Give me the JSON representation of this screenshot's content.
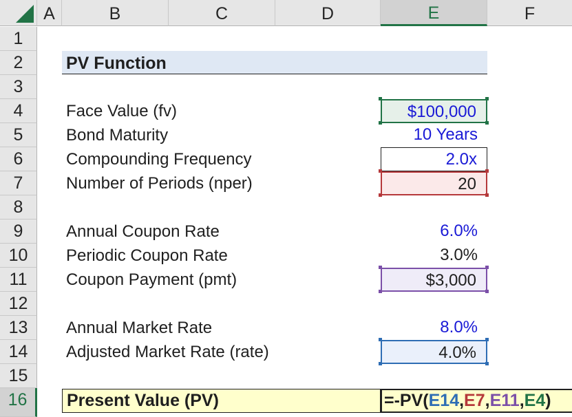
{
  "columns": [
    "A",
    "B",
    "C",
    "D",
    "E",
    "F"
  ],
  "rows": [
    "1",
    "2",
    "3",
    "4",
    "5",
    "6",
    "7",
    "8",
    "9",
    "10",
    "11",
    "12",
    "13",
    "14",
    "15",
    "16"
  ],
  "title": "PV Function",
  "items": [
    {
      "label": "Face Value (fv)",
      "value": "$100,000"
    },
    {
      "label": "Bond Maturity",
      "value": "10 Years"
    },
    {
      "label": "Compounding Frequency",
      "value": "2.0x"
    },
    {
      "label": "Number of Periods (nper)",
      "value": "20"
    },
    {
      "label": "Annual Coupon Rate",
      "value": "6.0%"
    },
    {
      "label": "Periodic Coupon Rate",
      "value": "3.0%"
    },
    {
      "label": "Coupon Payment (pmt)",
      "value": "$3,000"
    },
    {
      "label": "Annual Market Rate",
      "value": "8.0%"
    },
    {
      "label": "Adjusted Market Rate (rate)",
      "value": "4.0%"
    }
  ],
  "result": {
    "label": "Present Value (PV)",
    "formula": {
      "prefix": "=-PV(",
      "ref1": "E14",
      "sep1": ",",
      "ref2": "E7",
      "sep2": ",",
      "ref3": "E11",
      "sep3": ",",
      "ref4": "E4",
      "suffix": ")"
    }
  },
  "colors": {
    "fv": "#217346",
    "nper": "#b5383a",
    "pmt": "#7b4fa8",
    "rate": "#2e6db4",
    "input_blue": "#1a1ad6",
    "selected": "#217346"
  }
}
